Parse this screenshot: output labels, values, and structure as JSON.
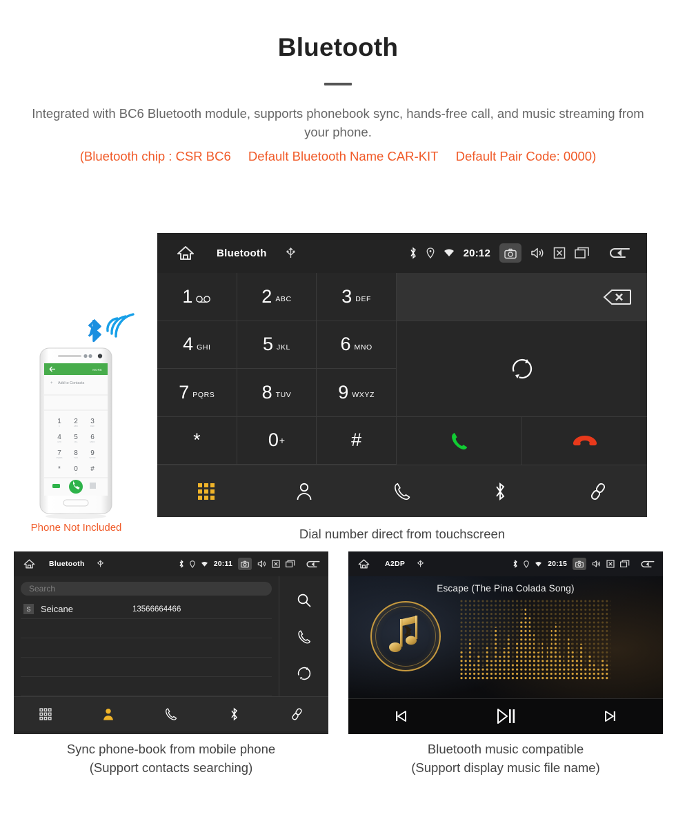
{
  "header": {
    "title": "Bluetooth",
    "description": "Integrated with BC6 Bluetooth module, supports phonebook sync, hands-free call, and music streaming from your phone.",
    "spec_chip": "(Bluetooth chip : CSR BC6",
    "spec_name": "Default Bluetooth Name CAR-KIT",
    "spec_pair": "Default Pair Code: 0000)",
    "accent_color": "#f05a28"
  },
  "dialer": {
    "topbar": {
      "title": "Bluetooth",
      "clock": "20:12",
      "icons": [
        "home-icon",
        "usb-icon",
        "bluetooth-icon",
        "location-icon",
        "wifi-icon",
        "camera-icon",
        "volume-icon",
        "close-box-icon",
        "recents-icon",
        "back-icon"
      ]
    },
    "keys": [
      {
        "num": "1",
        "sub": "∞",
        "type": "voicemail"
      },
      {
        "num": "2",
        "sub": "ABC"
      },
      {
        "num": "3",
        "sub": "DEF"
      },
      {
        "num": "4",
        "sub": "GHI"
      },
      {
        "num": "5",
        "sub": "JKL"
      },
      {
        "num": "6",
        "sub": "MNO"
      },
      {
        "num": "7",
        "sub": "PQRS"
      },
      {
        "num": "8",
        "sub": "TUV"
      },
      {
        "num": "9",
        "sub": "WXYZ"
      },
      {
        "num": "*",
        "sub": ""
      },
      {
        "num": "0",
        "sub": "+",
        "sup": true
      },
      {
        "num": "#",
        "sub": ""
      }
    ],
    "number_display_value": "",
    "backspace_label": "backspace-icon",
    "sync_label": "sync-icon",
    "call_label": "call-icon",
    "hangup_label": "hangup-icon",
    "nav": [
      {
        "name": "keypad",
        "active": true
      },
      {
        "name": "contacts",
        "active": false
      },
      {
        "name": "call-log",
        "active": false
      },
      {
        "name": "bluetooth",
        "active": false
      },
      {
        "name": "pair-link",
        "active": false
      }
    ],
    "caption": "Dial number direct from touchscreen"
  },
  "phone_mock": {
    "app_bar_back": "←",
    "app_bar_more": "MORE",
    "add_contact": "Add to Contacts",
    "keys": [
      "1",
      "2",
      "3",
      "4",
      "5",
      "6",
      "7",
      "8",
      "9",
      "*",
      "0",
      "#"
    ],
    "not_included_note": "Phone Not Included"
  },
  "phonebook": {
    "topbar": {
      "title": "Bluetooth",
      "clock": "20:11"
    },
    "search": {
      "placeholder": "Search",
      "value": ""
    },
    "contacts": [
      {
        "initial": "S",
        "name": "Seicane",
        "number": "13566664466"
      }
    ],
    "side_actions": [
      "search-icon",
      "call-icon",
      "sync-icon"
    ],
    "nav": [
      {
        "name": "keypad",
        "active": false
      },
      {
        "name": "contacts",
        "active": true
      },
      {
        "name": "call-log",
        "active": false
      },
      {
        "name": "bluetooth",
        "active": false
      },
      {
        "name": "pair-link",
        "active": false
      }
    ],
    "caption_line1": "Sync phone-book from mobile phone",
    "caption_line2": "(Support contacts searching)"
  },
  "music": {
    "topbar": {
      "title": "A2DP",
      "clock": "20:15"
    },
    "track_title": "Escape (The Pina Colada Song)",
    "controls": [
      "previous-icon",
      "play-pause-icon",
      "next-icon"
    ],
    "caption_line1": "Bluetooth music compatible",
    "caption_line2": "(Support display music file name)"
  }
}
